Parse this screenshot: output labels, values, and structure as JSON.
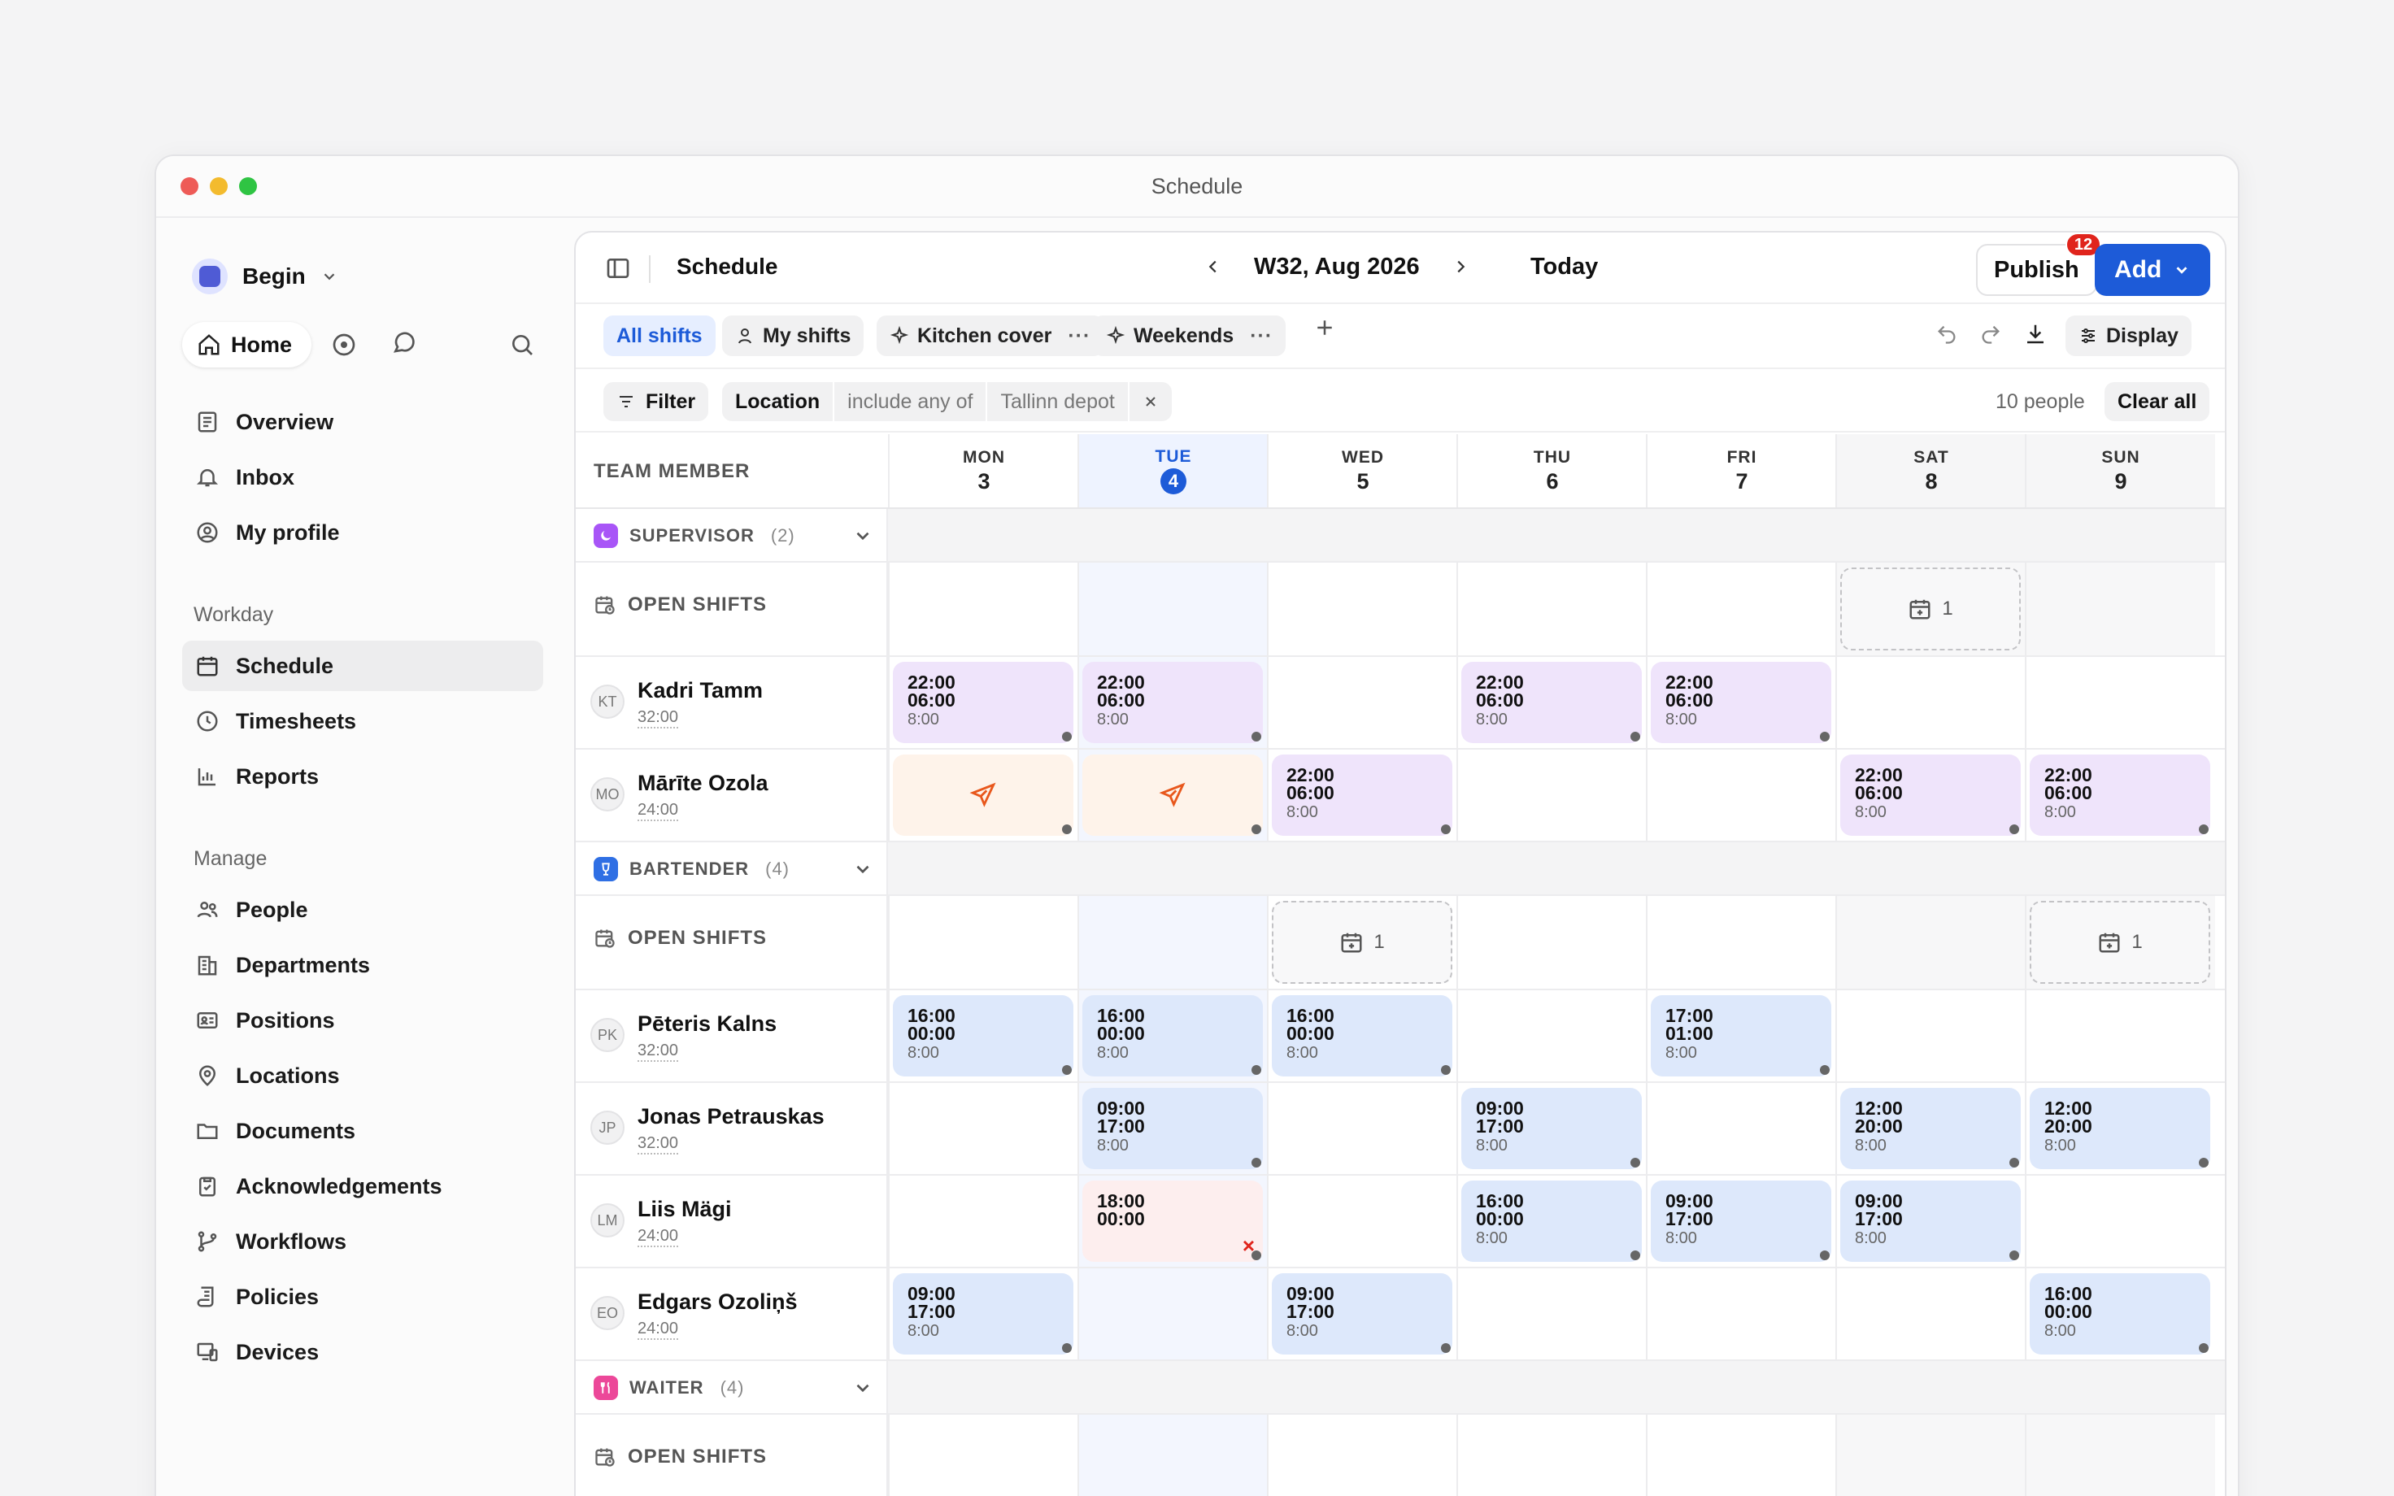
{
  "window": {
    "title": "Schedule"
  },
  "sidebar": {
    "workspace": "Begin",
    "home_label": "Home",
    "items_top": [
      {
        "label": "Overview",
        "icon": "overview-icon"
      },
      {
        "label": "Inbox",
        "icon": "bell-icon"
      },
      {
        "label": "My profile",
        "icon": "profile-icon"
      }
    ],
    "section_workday": "Workday",
    "items_workday": [
      {
        "label": "Schedule",
        "icon": "calendar-icon"
      },
      {
        "label": "Timesheets",
        "icon": "clock-icon"
      },
      {
        "label": "Reports",
        "icon": "chart-icon"
      }
    ],
    "section_manage": "Manage",
    "items_manage": [
      {
        "label": "People",
        "icon": "people-icon"
      },
      {
        "label": "Departments",
        "icon": "building-icon"
      },
      {
        "label": "Positions",
        "icon": "id-card-icon"
      },
      {
        "label": "Locations",
        "icon": "pin-icon"
      },
      {
        "label": "Documents",
        "icon": "folder-icon"
      },
      {
        "label": "Acknowledgements",
        "icon": "clipboard-icon"
      },
      {
        "label": "Workflows",
        "icon": "branch-icon"
      },
      {
        "label": "Policies",
        "icon": "scroll-icon"
      },
      {
        "label": "Devices",
        "icon": "devices-icon"
      }
    ]
  },
  "header": {
    "page_title": "Schedule",
    "week": "W32, Aug 2026",
    "today": "Today",
    "publish": "Publish",
    "publish_count": "12",
    "add": "Add"
  },
  "tabs": {
    "all": "All shifts",
    "mine": "My shifts",
    "kitchen": "Kitchen cover",
    "weekends": "Weekends",
    "more": "···",
    "display": "Display"
  },
  "filters": {
    "filter": "Filter",
    "field": "Location",
    "operator": "include any of",
    "value": "Tallinn depot",
    "people_count": "10 people",
    "clear": "Clear all"
  },
  "grid": {
    "member_header": "TEAM MEMBER",
    "days": [
      {
        "name": "MON",
        "date": "3"
      },
      {
        "name": "TUE",
        "date": "4"
      },
      {
        "name": "WED",
        "date": "5"
      },
      {
        "name": "THU",
        "date": "6"
      },
      {
        "name": "FRI",
        "date": "7"
      },
      {
        "name": "SAT",
        "date": "8"
      },
      {
        "name": "SUN",
        "date": "9"
      }
    ],
    "open_shifts_label": "OPEN SHIFTS",
    "open_count": "1",
    "groups": [
      {
        "name": "SUPERVISOR",
        "count": "(2)",
        "color": "#a855f7"
      },
      {
        "name": "BARTENDER",
        "count": "(4)",
        "color": "#2f6fe4"
      },
      {
        "name": "WAITER",
        "count": "(4)",
        "color": "#ec4899"
      }
    ],
    "people": [
      {
        "initials": "KT",
        "name": "Kadri Tamm",
        "hours": "32:00"
      },
      {
        "initials": "MO",
        "name": "Mārīte Ozola",
        "hours": "24:00"
      },
      {
        "initials": "PK",
        "name": "Pēteris Kalns",
        "hours": "32:00"
      },
      {
        "initials": "JP",
        "name": "Jonas Petrauskas",
        "hours": "32:00"
      },
      {
        "initials": "LM",
        "name": "Liis Mägi",
        "hours": "24:00"
      },
      {
        "initials": "EO",
        "name": "Edgars Ozoliņš",
        "hours": "24:00"
      }
    ],
    "shift_times": {
      "n_start": "22:00",
      "n_end": "06:00",
      "b1_start": "16:00",
      "b1_end": "00:00",
      "b2_start": "17:00",
      "b2_end": "01:00",
      "d_start": "09:00",
      "d_end": "17:00",
      "e_start": "12:00",
      "e_end": "20:00",
      "r_start": "18:00",
      "r_end": "00:00",
      "dur": "8:00"
    }
  }
}
